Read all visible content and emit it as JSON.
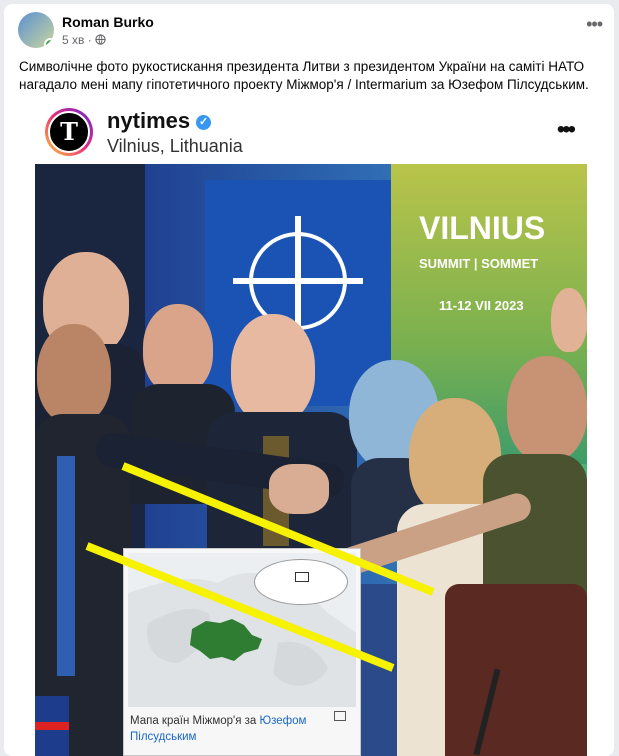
{
  "post": {
    "author": "Roman Burko",
    "time": "5 хв",
    "text": "Символічне фото рукостискання президента Литви з президентом України на саміті НАТО нагадало мені мапу гіпотетичного проекту Міжмор'я / Intermarium за Юзефом Пілсудським."
  },
  "embed": {
    "username": "nytimes",
    "location": "Vilnius, Lithuania",
    "logo_letter": "T",
    "verified_mark": "✓",
    "banner_title": "VILNIUS",
    "banner_subtitle": "SUMMIT | SOMMET",
    "banner_date": "11-12 VII 2023"
  },
  "map": {
    "caption_prefix": "Мапа країн Міжмор'я за ",
    "caption_link": "Юзефом Пілсудським"
  },
  "icons": {
    "globe": "globe-icon",
    "more": "more-icon",
    "verified": "verified-icon",
    "expand": "expand-icon"
  },
  "colors": {
    "highlight_line": "#f7f200",
    "map_region": "#2f7d33",
    "link": "#1a66c9"
  }
}
